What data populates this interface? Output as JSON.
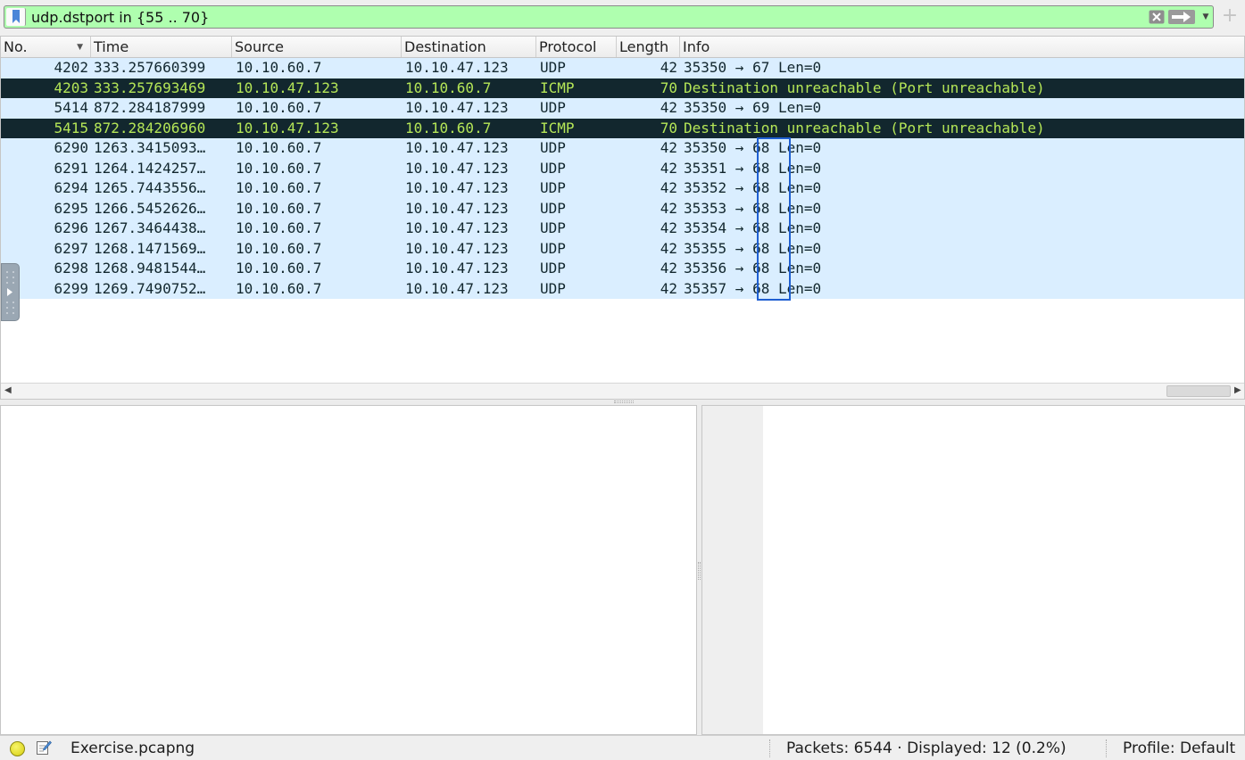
{
  "filter": {
    "value": "udp.dstport in {55 .. 70}",
    "bg_color": "#afffaf"
  },
  "icons": {
    "bookmark": "bookmark-icon",
    "clear": "clear-filter-icon",
    "apply": "apply-arrow-icon",
    "history": "chevron-down-icon",
    "add": "plus-icon",
    "sort": "sort-down-icon",
    "side_panel": "expand-arrow-icon",
    "status": "status-led-icon",
    "comment": "capture-comment-icon"
  },
  "columns": [
    {
      "label": "No."
    },
    {
      "label": "Time"
    },
    {
      "label": "Source"
    },
    {
      "label": "Destination"
    },
    {
      "label": "Protocol"
    },
    {
      "label": "Length"
    },
    {
      "label": "Info"
    }
  ],
  "row_colors": {
    "udp_bg": "#daeeff",
    "udp_fg": "#12272e",
    "icmp_bg": "#12272e",
    "icmp_fg": "#b5e657"
  },
  "packets": [
    {
      "no": "4202",
      "time": "333.257660399",
      "src": "10.10.60.7",
      "dst": "10.10.47.123",
      "proto": "UDP",
      "len": "42",
      "info": "35350 → 67 Len=0",
      "style": "udp"
    },
    {
      "no": "4203",
      "time": "333.257693469",
      "src": "10.10.47.123",
      "dst": "10.10.60.7",
      "proto": "ICMP",
      "len": "70",
      "info": "Destination unreachable (Port unreachable)",
      "style": "icmp"
    },
    {
      "no": "5414",
      "time": "872.284187999",
      "src": "10.10.60.7",
      "dst": "10.10.47.123",
      "proto": "UDP",
      "len": "42",
      "info": "35350 → 69 Len=0",
      "style": "udp"
    },
    {
      "no": "5415",
      "time": "872.284206960",
      "src": "10.10.47.123",
      "dst": "10.10.60.7",
      "proto": "ICMP",
      "len": "70",
      "info": "Destination unreachable (Port unreachable)",
      "style": "icmp"
    },
    {
      "no": "6290",
      "time": "1263.3415093…",
      "src": "10.10.60.7",
      "dst": "10.10.47.123",
      "proto": "UDP",
      "len": "42",
      "info": "35350 → 68 Len=0",
      "style": "udp"
    },
    {
      "no": "6291",
      "time": "1264.1424257…",
      "src": "10.10.60.7",
      "dst": "10.10.47.123",
      "proto": "UDP",
      "len": "42",
      "info": "35351 → 68 Len=0",
      "style": "udp"
    },
    {
      "no": "6294",
      "time": "1265.7443556…",
      "src": "10.10.60.7",
      "dst": "10.10.47.123",
      "proto": "UDP",
      "len": "42",
      "info": "35352 → 68 Len=0",
      "style": "udp"
    },
    {
      "no": "6295",
      "time": "1266.5452626…",
      "src": "10.10.60.7",
      "dst": "10.10.47.123",
      "proto": "UDP",
      "len": "42",
      "info": "35353 → 68 Len=0",
      "style": "udp"
    },
    {
      "no": "6296",
      "time": "1267.3464438…",
      "src": "10.10.60.7",
      "dst": "10.10.47.123",
      "proto": "UDP",
      "len": "42",
      "info": "35354 → 68 Len=0",
      "style": "udp"
    },
    {
      "no": "6297",
      "time": "1268.1471569…",
      "src": "10.10.60.7",
      "dst": "10.10.47.123",
      "proto": "UDP",
      "len": "42",
      "info": "35355 → 68 Len=0",
      "style": "udp"
    },
    {
      "no": "6298",
      "time": "1268.9481544…",
      "src": "10.10.60.7",
      "dst": "10.10.47.123",
      "proto": "UDP",
      "len": "42",
      "info": "35356 → 68 Len=0",
      "style": "udp"
    },
    {
      "no": "6299",
      "time": "1269.7490752…",
      "src": "10.10.60.7",
      "dst": "10.10.47.123",
      "proto": "UDP",
      "len": "42",
      "info": "35357 → 68 Len=0",
      "style": "udp"
    }
  ],
  "highlight": {
    "color": "#1f5fd1"
  },
  "status": {
    "file": "Exercise.pcapng",
    "packets": "Packets: 6544 · Displayed: 12 (0.2%)",
    "profile": "Profile: Default"
  }
}
